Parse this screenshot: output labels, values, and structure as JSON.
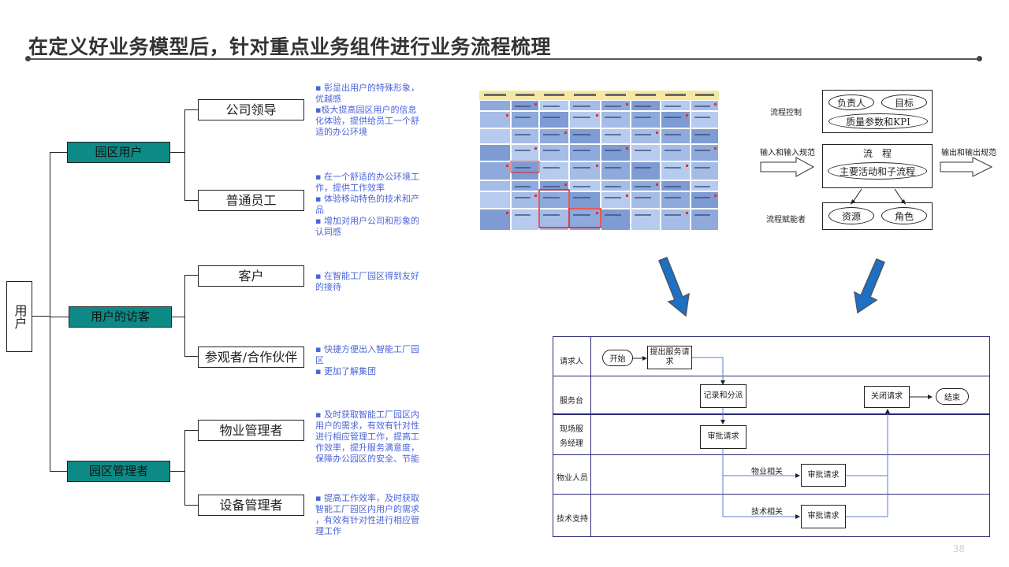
{
  "header": {
    "title": "在定义好业务模型后，针对重点业务组件进行业务流程梳理"
  },
  "tree": {
    "root": "用户",
    "groups": [
      {
        "label": "园区用户",
        "children": [
          "公司领导",
          "普通员工"
        ]
      },
      {
        "label": "用户的访客",
        "children": [
          "客户",
          "参观者/合作伙伴"
        ]
      },
      {
        "label": "园区管理者",
        "children": [
          "物业管理者",
          "设备管理者"
        ]
      }
    ]
  },
  "descriptions": {
    "d1": [
      "▪ 彰显出用户的特殊形象，",
      "优越感",
      "▪极大提高园区用户的信息",
      "化体验，提供给员工一个舒",
      "适的办公环境"
    ],
    "d2": [
      "▪ 在一个舒适的办公环境工",
      "作，提供工作效率",
      "▪ 体验移动特色的技术和产",
      "品",
      "▪ 增加对用户公司和形象的",
      "认同感"
    ],
    "d3": [
      "▪ 在智能工厂园区得到友好",
      "的接待"
    ],
    "d4": [
      "▪ 快捷方便出入智能工厂园",
      "区",
      "▪ 更加了解集团"
    ],
    "d5": [
      "▪ 及时获取智能工厂园区内",
      "用户的需求，有效有针对性",
      "进行相应管理工作，提高工",
      "作效率，提升服务满意度，",
      "保障办公园区的安全、节能"
    ],
    "d6": [
      "▪ 提高工作效率，及时获取",
      "智能工厂园区内用户的需求",
      "，有效有针对性进行相应管",
      "理工作"
    ]
  },
  "process_model": {
    "control": "流程控制",
    "top_items": [
      "负责人",
      "目标",
      "质量参数和KPI"
    ],
    "input": "输入和输入规范",
    "output": "输出和输出规范",
    "center_title": "流　程",
    "center_sub": "主要活动和子流程",
    "enabler": "流程赋能者",
    "bottom_items": [
      "资源",
      "角色"
    ]
  },
  "swimlane": {
    "lanes": [
      "请求人",
      "服务台",
      "现场服务经理",
      "物业人员",
      "技术支持"
    ],
    "nodes": {
      "start": "开始",
      "submit": "提出服务请求",
      "record": "记录和分派",
      "close": "关闭请求",
      "end": "结束",
      "approve1": "审批请求",
      "approve2": "审批请求",
      "approve3": "审批请求"
    },
    "edge_labels": {
      "property": "物业相关",
      "tech": "技术相关"
    }
  },
  "matrix_icon": "process-matrix-thumbnail",
  "arrow_color": "#1f6fc4",
  "accent_teal": "#0e8a86",
  "page_number": "38"
}
